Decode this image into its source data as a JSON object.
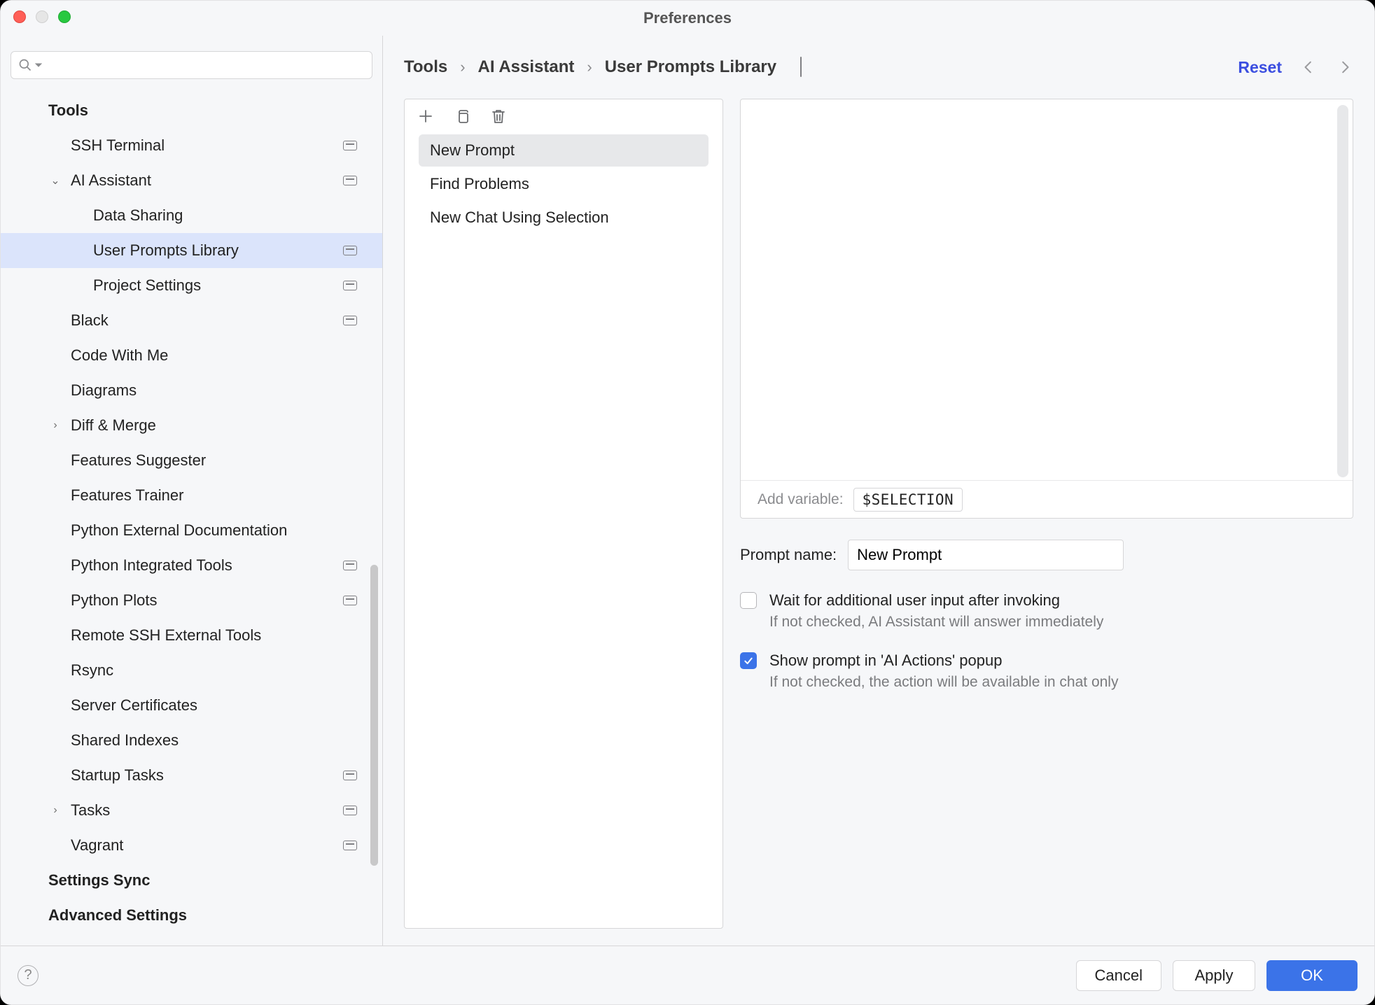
{
  "window": {
    "title": "Preferences"
  },
  "search": {
    "value": ""
  },
  "sidebar": {
    "items": [
      {
        "label": "Tools",
        "bold": true,
        "indent": 1,
        "scope": false,
        "expander": ""
      },
      {
        "label": "SSH Terminal",
        "bold": false,
        "indent": 2,
        "scope": true,
        "expander": ""
      },
      {
        "label": "AI Assistant",
        "bold": false,
        "indent": 2,
        "scope": true,
        "expander": "down"
      },
      {
        "label": "Data Sharing",
        "bold": false,
        "indent": 3,
        "scope": false,
        "expander": ""
      },
      {
        "label": "User Prompts Library",
        "bold": false,
        "indent": 3,
        "scope": true,
        "expander": "",
        "selected": true
      },
      {
        "label": "Project Settings",
        "bold": false,
        "indent": 3,
        "scope": true,
        "expander": ""
      },
      {
        "label": "Black",
        "bold": false,
        "indent": 2,
        "scope": true,
        "expander": ""
      },
      {
        "label": "Code With Me",
        "bold": false,
        "indent": 2,
        "scope": false,
        "expander": ""
      },
      {
        "label": "Diagrams",
        "bold": false,
        "indent": 2,
        "scope": false,
        "expander": ""
      },
      {
        "label": "Diff & Merge",
        "bold": false,
        "indent": 2,
        "scope": false,
        "expander": "right"
      },
      {
        "label": "Features Suggester",
        "bold": false,
        "indent": 2,
        "scope": false,
        "expander": ""
      },
      {
        "label": "Features Trainer",
        "bold": false,
        "indent": 2,
        "scope": false,
        "expander": ""
      },
      {
        "label": "Python External Documentation",
        "bold": false,
        "indent": 2,
        "scope": false,
        "expander": ""
      },
      {
        "label": "Python Integrated Tools",
        "bold": false,
        "indent": 2,
        "scope": true,
        "expander": ""
      },
      {
        "label": "Python Plots",
        "bold": false,
        "indent": 2,
        "scope": true,
        "expander": ""
      },
      {
        "label": "Remote SSH External Tools",
        "bold": false,
        "indent": 2,
        "scope": false,
        "expander": ""
      },
      {
        "label": "Rsync",
        "bold": false,
        "indent": 2,
        "scope": false,
        "expander": ""
      },
      {
        "label": "Server Certificates",
        "bold": false,
        "indent": 2,
        "scope": false,
        "expander": ""
      },
      {
        "label": "Shared Indexes",
        "bold": false,
        "indent": 2,
        "scope": false,
        "expander": ""
      },
      {
        "label": "Startup Tasks",
        "bold": false,
        "indent": 2,
        "scope": true,
        "expander": ""
      },
      {
        "label": "Tasks",
        "bold": false,
        "indent": 2,
        "scope": true,
        "expander": "right"
      },
      {
        "label": "Vagrant",
        "bold": false,
        "indent": 2,
        "scope": true,
        "expander": ""
      },
      {
        "label": "Settings Sync",
        "bold": true,
        "indent": 1,
        "scope": false,
        "expander": ""
      },
      {
        "label": "Advanced Settings",
        "bold": true,
        "indent": 1,
        "scope": false,
        "expander": ""
      }
    ]
  },
  "breadcrumb": {
    "parts": [
      "Tools",
      "AI Assistant",
      "User Prompts Library"
    ],
    "reset": "Reset"
  },
  "prompts": {
    "items": [
      {
        "label": "New Prompt",
        "selected": true
      },
      {
        "label": "Find Problems",
        "selected": false
      },
      {
        "label": "New Chat Using Selection",
        "selected": false
      }
    ]
  },
  "editor": {
    "add_variable_label": "Add variable:",
    "variable_chip": "$SELECTION",
    "content": ""
  },
  "form": {
    "prompt_name_label": "Prompt name:",
    "prompt_name_value": "New Prompt",
    "wait_label": "Wait for additional user input after invoking",
    "wait_desc": "If not checked, AI Assistant will answer immediately",
    "wait_checked": false,
    "show_label": "Show prompt in 'AI Actions' popup",
    "show_desc": "If not checked, the action will be available in chat only",
    "show_checked": true
  },
  "footer": {
    "cancel": "Cancel",
    "apply": "Apply",
    "ok": "OK"
  }
}
